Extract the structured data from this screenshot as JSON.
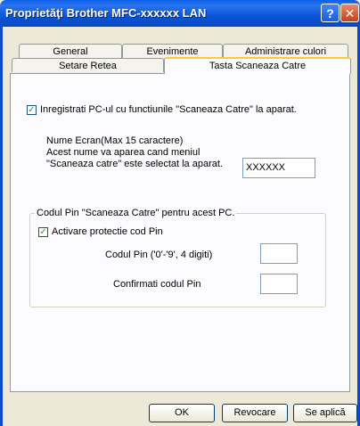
{
  "window": {
    "title": "Proprietăţi Brother MFC-xxxxxx LAN",
    "help_label": "?",
    "close_label": "✕"
  },
  "tabs": {
    "row1": [
      "General",
      "Evenimente",
      "Administrare culori"
    ],
    "row2": [
      "Setare Retea",
      "Tasta Scaneaza Catre"
    ],
    "active": "Tasta Scaneaza Catre"
  },
  "register": {
    "label": "Inregistrati PC-ul cu functiunile \"Scaneaza Catre\" la aparat.",
    "checked": true
  },
  "display_name": {
    "line1": "Nume Ecran(Max 15 caractere)",
    "line2": "Acest nume va aparea cand meniul",
    "line3": "\"Scaneaza catre\" este selectat la aparat.",
    "value": "XXXXXX"
  },
  "pin_group": {
    "title": "Codul Pin \"Scaneaza Catre\" pentru acest PC.",
    "enable_label": "Activare protectie cod Pin",
    "enable_checked": true,
    "pin_label": "Codul Pin ('0'-'9', 4 digiti)",
    "pin_value": "",
    "confirm_label": "Confirmati codul Pin",
    "confirm_value": ""
  },
  "buttons": {
    "ok": "OK",
    "cancel": "Revocare",
    "apply": "Se aplică"
  }
}
